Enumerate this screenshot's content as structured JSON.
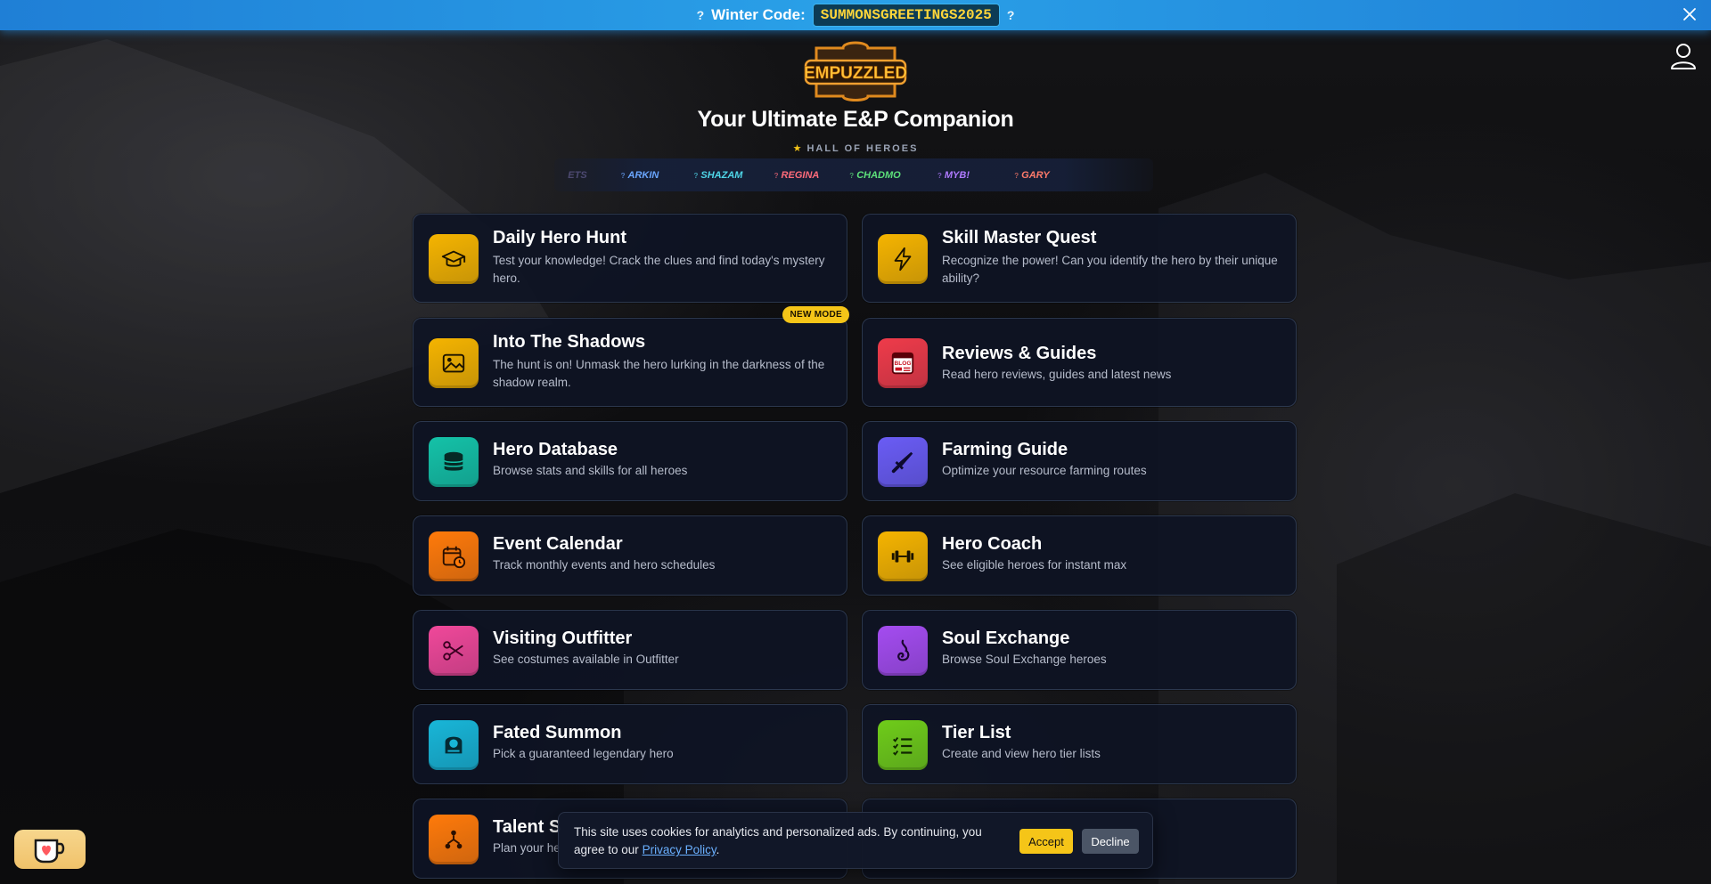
{
  "banner": {
    "label": "Winter Code:",
    "code": "SUMMONSGREETINGS2025",
    "gift_glyph": "?",
    "close_icon": "close-icon"
  },
  "header": {
    "logo_text": "EMPUZZLED",
    "title": "Your Ultimate E&P Companion",
    "hall_of_heroes": "HALL OF HEROES",
    "heroes": [
      {
        "name": "ETS",
        "color": "#8a7fc8"
      },
      {
        "name": "ARKIN",
        "color": "#6aa6ff"
      },
      {
        "name": "SHAZAM",
        "color": "#4fd6e8"
      },
      {
        "name": "REGINA",
        "color": "#ff6b7a"
      },
      {
        "name": "CHADMO",
        "color": "#5de07a"
      },
      {
        "name": "MYB!",
        "color": "#b07aff"
      },
      {
        "name": "GARY",
        "color": "#ff7a6a"
      }
    ]
  },
  "cards": [
    {
      "title": "Daily Hero Hunt",
      "desc": "Test your knowledge! Crack the clues and find today's mystery hero.",
      "icon": "graduation-cap-icon",
      "color": "#f5b400"
    },
    {
      "title": "Skill Master Quest",
      "desc": "Recognize the power! Can you identify the hero by their unique ability?",
      "icon": "lightning-icon",
      "color": "#f5b400"
    },
    {
      "title": "Into The Shadows",
      "desc": "The hunt is on! Unmask the hero lurking in the darkness of the shadow realm.",
      "icon": "image-icon",
      "color": "#f5b400",
      "badge": "NEW MODE"
    },
    {
      "title": "Reviews & Guides",
      "desc": "Read hero reviews, guides and latest news",
      "icon": "blog-icon",
      "color": "#ef3b4a"
    },
    {
      "title": "Hero Database",
      "desc": "Browse stats and skills for all heroes",
      "icon": "database-icon",
      "color": "#14c2a8"
    },
    {
      "title": "Farming Guide",
      "desc": "Optimize your resource farming routes",
      "icon": "sword-icon",
      "color": "#6a5cf5"
    },
    {
      "title": "Event Calendar",
      "desc": "Track monthly events and hero schedules",
      "icon": "calendar-icon",
      "color": "#ff7a0a"
    },
    {
      "title": "Hero Coach",
      "desc": "See eligible heroes for instant max",
      "icon": "dumbbell-icon",
      "color": "#f5b400"
    },
    {
      "title": "Visiting Outfitter",
      "desc": "See costumes available in Outfitter",
      "icon": "scissors-icon",
      "color": "#f0489a"
    },
    {
      "title": "Soul Exchange",
      "desc": "Browse Soul Exchange heroes",
      "icon": "soul-icon",
      "color": "#a44cf0"
    },
    {
      "title": "Fated Summon",
      "desc": "Pick a guaranteed legendary hero",
      "icon": "summon-icon",
      "color": "#18b6d8"
    },
    {
      "title": "Tier List",
      "desc": "Create and view hero tier lists",
      "icon": "checklist-icon",
      "color": "#6fcc1a"
    },
    {
      "title": "Talent S",
      "desc": "Plan your he",
      "icon": "talent-tree-icon",
      "color": "#ff7a0a"
    },
    {
      "title": "",
      "desc": "",
      "icon": "",
      "color": ""
    }
  ],
  "cookie": {
    "text": "This site uses cookies for analytics and personalized ads. By continuing, you agree to our",
    "link": "Privacy Policy",
    "after_link": ".",
    "accept": "Accept",
    "decline": "Decline"
  },
  "kofi": {
    "icon": "kofi-cup-icon"
  }
}
